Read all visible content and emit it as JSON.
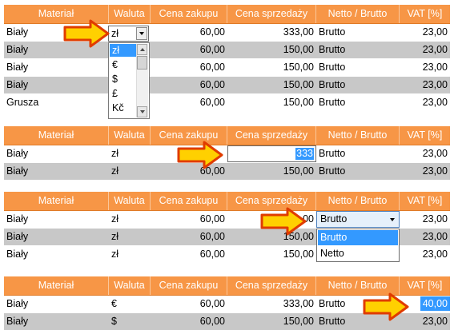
{
  "headers": [
    "Materiał",
    "Waluta",
    "Cena zakupu",
    "Cena sprzedaży",
    "Netto / Brutto",
    "VAT [%]"
  ],
  "panel1": {
    "rows": [
      {
        "material": "Biały",
        "currency": "zł",
        "buy": "60,00",
        "sell": "333,00",
        "netto_brutto": "Brutto",
        "vat": "23,00"
      },
      {
        "material": "Biały",
        "currency": "",
        "buy": "60,00",
        "sell": "150,00",
        "netto_brutto": "Brutto",
        "vat": "23,00"
      },
      {
        "material": "Biały",
        "currency": "",
        "buy": "60,00",
        "sell": "150,00",
        "netto_brutto": "Brutto",
        "vat": "23,00"
      },
      {
        "material": "Biały",
        "currency": "",
        "buy": "60,00",
        "sell": "150,00",
        "netto_brutto": "Brutto",
        "vat": "23,00"
      },
      {
        "material": "Grusza",
        "currency": "",
        "buy": "60,00",
        "sell": "150,00",
        "netto_brutto": "Brutto",
        "vat": "23,00"
      }
    ],
    "currency_options": [
      "zł",
      "€",
      "$",
      "£",
      "Kč"
    ],
    "selected_currency": "zł"
  },
  "panel2": {
    "rows": [
      {
        "material": "Biały",
        "currency": "zł",
        "buy": "",
        "sell_selected": "333",
        "netto_brutto": "Brutto",
        "vat": "23,00"
      },
      {
        "material": "Biały",
        "currency": "zł",
        "buy": "60,00",
        "sell": "150,00",
        "netto_brutto": "Brutto",
        "vat": "23,00"
      }
    ]
  },
  "panel3": {
    "rows": [
      {
        "material": "Biały",
        "currency": "zł",
        "buy": "60,00",
        "sell": "00",
        "netto_brutto": "Brutto",
        "vat": "23,00"
      },
      {
        "material": "Biały",
        "currency": "zł",
        "buy": "60,00",
        "sell": "150,00",
        "netto_brutto": "",
        "vat": "23,00"
      },
      {
        "material": "Biały",
        "currency": "zł",
        "buy": "60,00",
        "sell": "150,00",
        "netto_brutto": "",
        "vat": "23,00"
      }
    ],
    "options": [
      "Brutto",
      "Netto"
    ],
    "selected": "Brutto"
  },
  "panel4": {
    "rows": [
      {
        "material": "Biały",
        "currency": "€",
        "buy": "60,00",
        "sell": "333,00",
        "netto_brutto": "Brutto",
        "vat_editing": "40,00"
      },
      {
        "material": "Biały",
        "currency": "$",
        "buy": "60,00",
        "sell": "150,00",
        "netto_brutto": "Brutto",
        "vat": "23,00"
      }
    ]
  },
  "colors": {
    "header_bg": "#f79646",
    "row_gray": "#c8c8c8",
    "selection": "#3399ff",
    "arrow_fill": "#ffd000",
    "arrow_stroke": "#e03c00"
  }
}
